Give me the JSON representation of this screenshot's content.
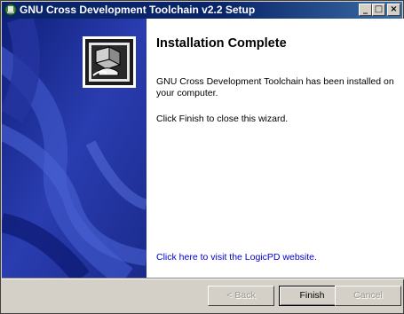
{
  "window": {
    "title": "GNU Cross Development Toolchain v2.2 Setup"
  },
  "titlebar_buttons": {
    "minimize": "_",
    "maximize": "□",
    "close": "×"
  },
  "page": {
    "heading": "Installation Complete",
    "message": "GNU Cross Development Toolchain has been installed on your computer.",
    "instruction": "Click Finish to close this wizard.",
    "link": "Click here to visit the LogicPD website."
  },
  "buttons": {
    "back": "< Back",
    "finish": "Finish",
    "cancel": "Cancel"
  },
  "colors": {
    "title_bar": "#0a246a",
    "sidebar": "#1d2f9a",
    "link": "#0000cc"
  },
  "icons": {
    "title": "installer-icon",
    "sidebar": "computer-install-icon"
  }
}
